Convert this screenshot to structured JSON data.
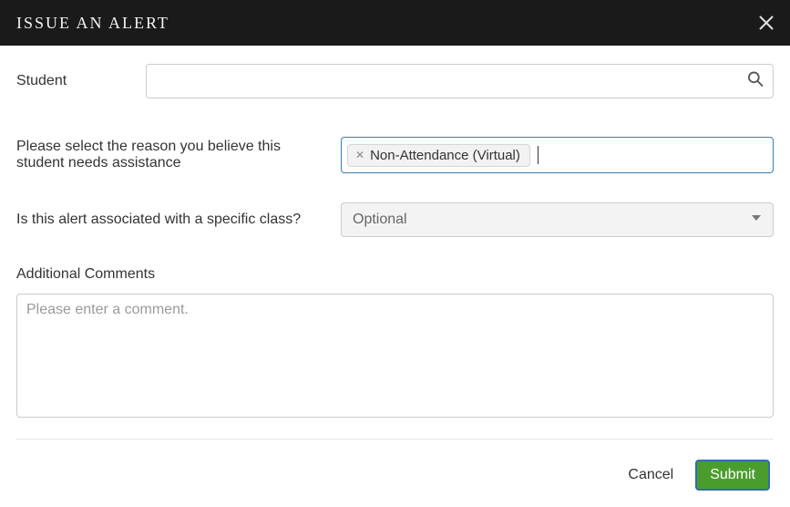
{
  "header": {
    "title": "ISSUE AN ALERT"
  },
  "student": {
    "label": "Student",
    "value": "",
    "placeholder": ""
  },
  "reason": {
    "label": "Please select the reason you believe this student needs assistance",
    "tags": [
      {
        "label": "Non-Attendance (Virtual)"
      }
    ]
  },
  "class_select": {
    "label": "Is this alert associated with a specific class?",
    "selected": "Optional"
  },
  "comments": {
    "label": "Additional Comments",
    "value": "",
    "placeholder": "Please enter a comment."
  },
  "footer": {
    "cancel": "Cancel",
    "submit": "Submit"
  }
}
